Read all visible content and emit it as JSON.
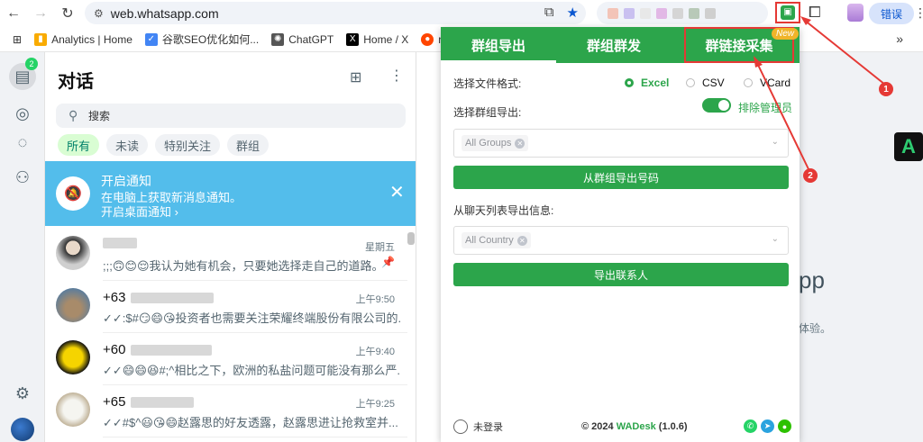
{
  "browser": {
    "url": "web.whatsapp.com",
    "error_button": "错误",
    "bookmarks": [
      {
        "label": "Analytics | Home",
        "icon": "analytics-icon",
        "color": "#f9ab00"
      },
      {
        "label": "谷歌SEO优化如何...",
        "icon": "seo-icon",
        "color": "#4285f4"
      },
      {
        "label": "ChatGPT",
        "icon": "chatgpt-icon",
        "color": "#555555"
      },
      {
        "label": "Home / X",
        "icon": "x-icon",
        "color": "#000000"
      },
      {
        "label": "reddit",
        "icon": "reddit-icon",
        "color": "#ff4500"
      }
    ]
  },
  "whatsapp": {
    "title": "对话",
    "unread_badge": "2",
    "search_placeholder": "搜索",
    "filters": [
      "所有",
      "未读",
      "特别关注",
      "群组"
    ],
    "notice": {
      "title": "开启通知",
      "line1": "在电脑上获取新消息通知。",
      "line2": "开启桌面通知 ›"
    },
    "chats": [
      {
        "name": "",
        "time": "星期五",
        "message": ";;;🙃😊😌我认为她有机会，只要她选择走自己的道路。",
        "pinned": true
      },
      {
        "name": "+63",
        "time": "上午9:50",
        "message": "✓✓:$#😏😄😘投资者也需要关注荣耀终端股份有限公司的..."
      },
      {
        "name": "+60",
        "time": "上午9:40",
        "message": "✓✓😄😄😆#;^相比之下，欧洲的私盐问题可能没有那么严..."
      },
      {
        "name": "+65",
        "time": "上午9:25",
        "message": "✓✓#$^😃😘😄赵露思的好友透露，赵露思进让抢救室并..."
      }
    ],
    "background_title_fragment": "pp",
    "background_text_fragment": "体验。"
  },
  "extension": {
    "tabs": [
      "群组导出",
      "群组群发",
      "群链接采集"
    ],
    "new_tag": "New",
    "format_label": "选择文件格式:",
    "formats": [
      "Excel",
      "CSV",
      "VCard"
    ],
    "selected_format": "Excel",
    "group_label": "选择群组导出:",
    "exclude_admin_label": "排除管理员",
    "group_select_value": "All Groups",
    "export_group_button": "从群组导出号码",
    "chat_list_label": "从聊天列表导出信息:",
    "country_select_value": "All Country",
    "export_contacts_button": "导出联系人",
    "footer": {
      "login_status": "未登录",
      "copyright_prefix": "© 2024",
      "brand": "WADesk",
      "version": "(1.0.6)"
    },
    "accent_color": "#2ca54b"
  },
  "annotations": [
    "1",
    "2"
  ]
}
